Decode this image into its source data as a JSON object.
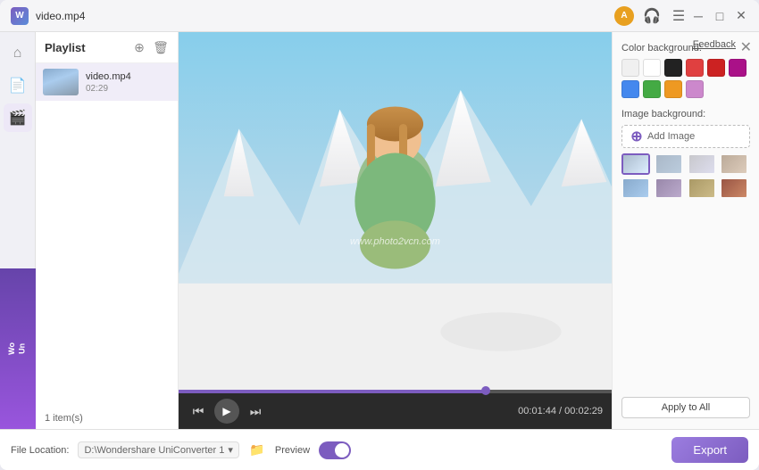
{
  "window": {
    "title": "video.mp4",
    "app_icon": "W",
    "controls": [
      "minimize",
      "maximize",
      "close"
    ],
    "feedback_label": "Feedback",
    "close_label": "✕"
  },
  "titlebar": {
    "right_icons": [
      "user-icon",
      "headset-icon",
      "menu-icon",
      "minimize-icon",
      "maximize-icon",
      "close-icon"
    ]
  },
  "sidebar": {
    "items": [
      {
        "name": "home-icon",
        "icon": "⌂",
        "active": false
      },
      {
        "name": "file-icon",
        "icon": "📄",
        "active": false
      },
      {
        "name": "convert-icon",
        "icon": "🎬",
        "active": true
      }
    ]
  },
  "playlist": {
    "title": "Playlist",
    "items": [
      {
        "name": "video.mp4",
        "duration": "02:29"
      }
    ],
    "count": "1 item(s)"
  },
  "player": {
    "watermark": "www.photo2vcn.com",
    "progress_pct": 71,
    "current_time": "00:01:44",
    "total_time": "00:02:29",
    "controls": {
      "prev_label": "⏮",
      "play_label": "▶",
      "next_label": "⏭"
    }
  },
  "bottom_bar": {
    "file_location_label": "File Location:",
    "file_location_value": "D:\\Wondershare UniConverter 1",
    "preview_label": "Preview",
    "preview_on": true,
    "export_label": "Export"
  },
  "right_panel": {
    "color_bg_label": "Color background:",
    "colors": [
      {
        "hex": "#f0f0f0",
        "selected": false
      },
      {
        "hex": "#ffffff",
        "selected": false
      },
      {
        "hex": "#222222",
        "selected": false
      },
      {
        "hex": "#e04040",
        "selected": false
      },
      {
        "hex": "#cc2222",
        "selected": false
      },
      {
        "hex": "#aa1188",
        "selected": false
      },
      {
        "hex": "#4488ee",
        "selected": false
      },
      {
        "hex": "#44aa44",
        "selected": false
      },
      {
        "hex": "#ee9922",
        "selected": false
      },
      {
        "hex": "#cc88cc",
        "selected": false
      }
    ],
    "image_bg_label": "Image background:",
    "add_image_label": "Add Image",
    "bg_images": [
      {
        "name": "bg-selected",
        "selected": true,
        "color": "linear-gradient(135deg, #aabbcc, #ddeeff)"
      },
      {
        "name": "bg-2",
        "selected": false,
        "color": "linear-gradient(135deg, #aab8c8, #bbccdd)"
      },
      {
        "name": "bg-3",
        "selected": false,
        "color": "linear-gradient(135deg, #c8c8cc, #ddddee)"
      },
      {
        "name": "bg-4",
        "selected": false,
        "color": "linear-gradient(135deg, #bbaa99, #ddccbb)"
      },
      {
        "name": "bg-5",
        "selected": false,
        "color": "linear-gradient(135deg, #88aacc, #aaccee)"
      },
      {
        "name": "bg-6",
        "selected": false,
        "color": "linear-gradient(135deg, #9988aa, #bbaacc)"
      },
      {
        "name": "bg-7",
        "selected": false,
        "color": "linear-gradient(135deg, #aa9966, #ccbb88)"
      },
      {
        "name": "bg-8",
        "selected": false,
        "color": "linear-gradient(135deg, #995544, #cc8866)"
      }
    ],
    "apply_all_label": "Apply to All"
  },
  "promo": {
    "text": "Wo Un"
  }
}
